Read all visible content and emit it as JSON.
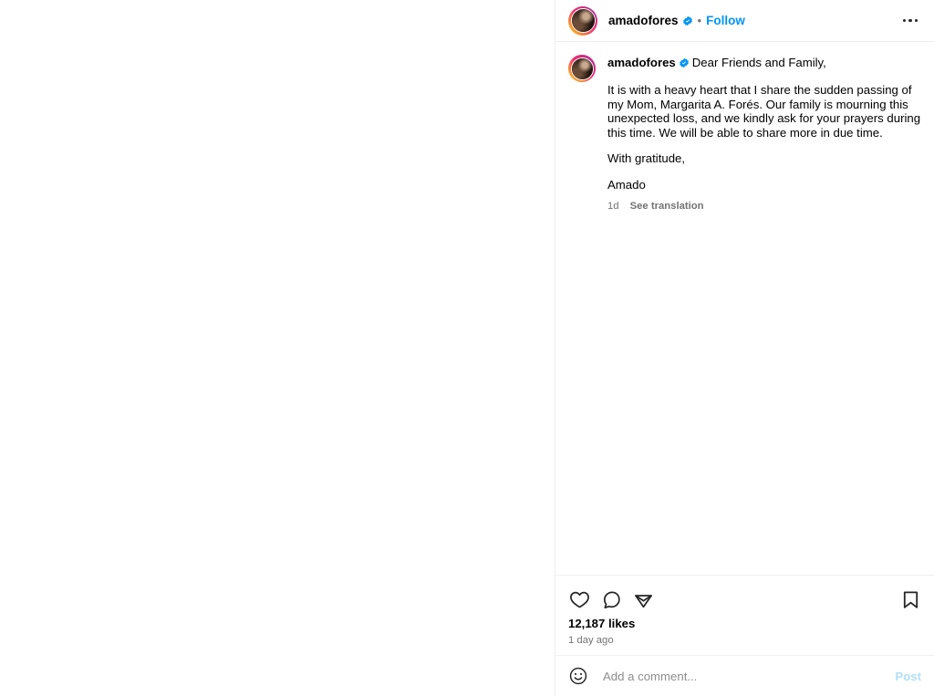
{
  "post": {
    "header": {
      "username": "amadofores",
      "verified_icon": "verified-badge-icon",
      "separator": "•",
      "follow_label": "Follow",
      "more_options_icon": "ellipsis-icon",
      "avatar_name": "amadofores-avatar"
    },
    "caption": {
      "username": "amadofores",
      "verified_icon": "verified-badge-icon",
      "greeting": "Dear Friends and Family,",
      "body": "It is with a heavy heart that I share the sudden passing of my Mom, Margarita A. Forés. Our family is mourning this unexpected loss, and we kindly ask for your prayers during this time. We will be able to share more in due time.",
      "closing": "With gratitude,",
      "signature": "Amado",
      "time_ago": "1d",
      "translate_label": "See translation"
    },
    "actions": {
      "like_icon": "heart-icon",
      "comment_icon": "comment-bubble-icon",
      "share_icon": "share-paper-plane-icon",
      "save_icon": "bookmark-icon",
      "likes_text": "12,187 likes",
      "date_text": "1 day ago"
    },
    "composer": {
      "emoji_icon": "emoji-smiley-icon",
      "placeholder": "Add a comment...",
      "value": "",
      "post_label": "Post"
    }
  },
  "colors": {
    "accent_blue": "#0095F6",
    "post_disabled_blue": "#B2DFFC",
    "text_primary": "#000000",
    "text_secondary": "#737373",
    "border": "#EFEFEF",
    "background": "#FFFFFF"
  }
}
